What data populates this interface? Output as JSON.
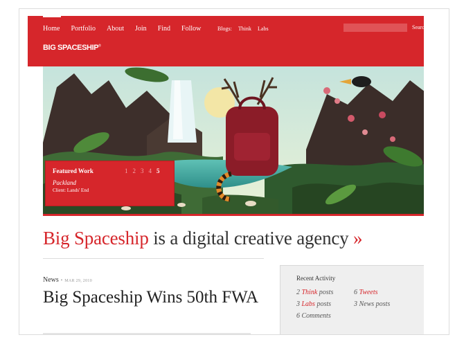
{
  "nav": {
    "items": [
      "Home",
      "Portfolio",
      "About",
      "Join",
      "Find",
      "Follow"
    ],
    "blogs_label": "Blogs:",
    "blogs": [
      "Think",
      "Labs"
    ],
    "search_label": "Search",
    "search_value": ""
  },
  "brand": {
    "logo": "BIG SPACESHIP",
    "mark": "®"
  },
  "featured": {
    "title": "Featured Work",
    "pages": [
      "1",
      "2",
      "3",
      "4",
      "5"
    ],
    "active_page": "5",
    "project": "Packland",
    "client": "Client: Lands' End"
  },
  "tagline": {
    "name": "Big Spaceship",
    "rest": " is a digital creative agency ",
    "arrow": "»"
  },
  "news": {
    "category": "News",
    "separator": "•",
    "date": "MAR 29, 2010",
    "headline": "Big Spaceship Wins 50th FWA"
  },
  "recent": {
    "title": "Recent Activity",
    "items": [
      {
        "count": "2",
        "link": "Think",
        "suffix": " posts"
      },
      {
        "count": "6",
        "link": "Tweets",
        "suffix": ""
      },
      {
        "count": "3",
        "link": "Labs",
        "suffix": " posts"
      },
      {
        "count": "3",
        "link": "",
        "suffix": "News posts"
      },
      {
        "count": "6",
        "link": "",
        "suffix": "Comments"
      }
    ]
  },
  "colors": {
    "brand_red": "#d6262b",
    "text": "#333333"
  }
}
